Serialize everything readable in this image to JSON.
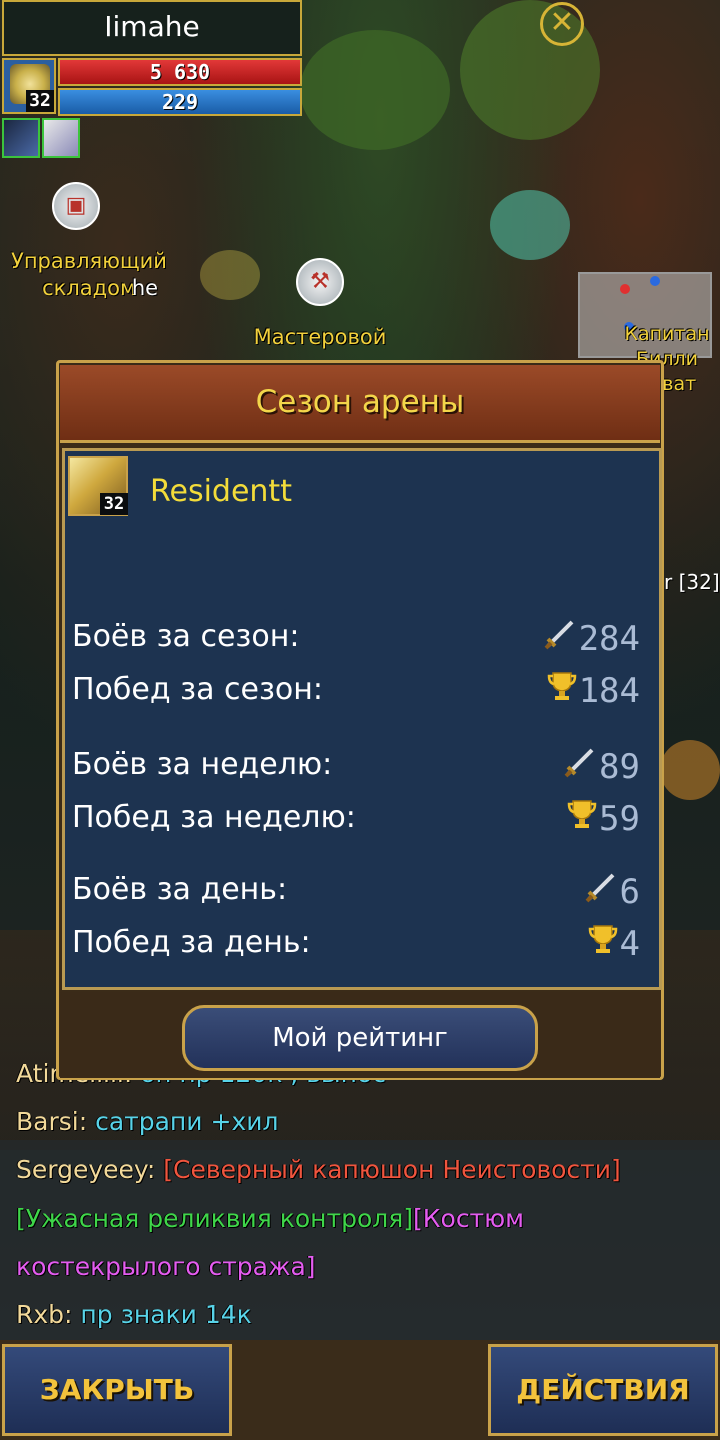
{
  "hud": {
    "player_name": "Iimahe",
    "level": "32",
    "hp": "5 630",
    "mp": "229"
  },
  "npcs": {
    "storage_manager_label": "Управляющий складом",
    "storage_manager_suffix": "he",
    "craftsman_label": "Мастеровой",
    "captain_label_1": "Капитан",
    "captain_label_2": "Билли",
    "captain_label_3": "Эхват",
    "side_player": "r [32]"
  },
  "dialog": {
    "title": "Сезон арены",
    "player_name": "Residentt",
    "player_level": "32",
    "stats": [
      {
        "label": "Боёв за сезон:",
        "value": "284",
        "icon": "sword-icon"
      },
      {
        "label": "Побед за сезон:",
        "value": "184",
        "icon": "trophy-icon"
      },
      {
        "label": "Боёв за неделю:",
        "value": "89",
        "icon": "sword-icon"
      },
      {
        "label": "Побед за неделю:",
        "value": "59",
        "icon": "trophy-icon"
      },
      {
        "label": "Боёв за день:",
        "value": "6",
        "icon": "sword-icon"
      },
      {
        "label": "Побед за день:",
        "value": "4",
        "icon": "trophy-icon"
      }
    ],
    "rating_button": "Мой рейтинг"
  },
  "chat": {
    "line0": {
      "name": "Atimeiiiii:",
      "text": "on пр 120к , вынос"
    },
    "line1": {
      "name": "Barsi:",
      "text": "сатрапи +хил"
    },
    "line2": {
      "name": "Sergeyeey:",
      "item1": "[Северный капюшон Неистовости]"
    },
    "line3": {
      "item2": "[Ужасная реликвия контроля]",
      "item3_a": "[Костюм"
    },
    "line4": {
      "item3_b": "костекрылого стража]"
    },
    "line5": {
      "name": "Rxb:",
      "text": "пр знаки 14к"
    }
  },
  "bottom": {
    "close_label": "ЗАКРЫТЬ",
    "actions_label": "ДЕЙСТВИЯ"
  },
  "colors": {
    "gold": "#c9a24a",
    "title_yellow": "#f3d64a",
    "hp_red": "#e23838",
    "mp_blue": "#3a8ee0",
    "dialog_blue": "#1d3350"
  }
}
